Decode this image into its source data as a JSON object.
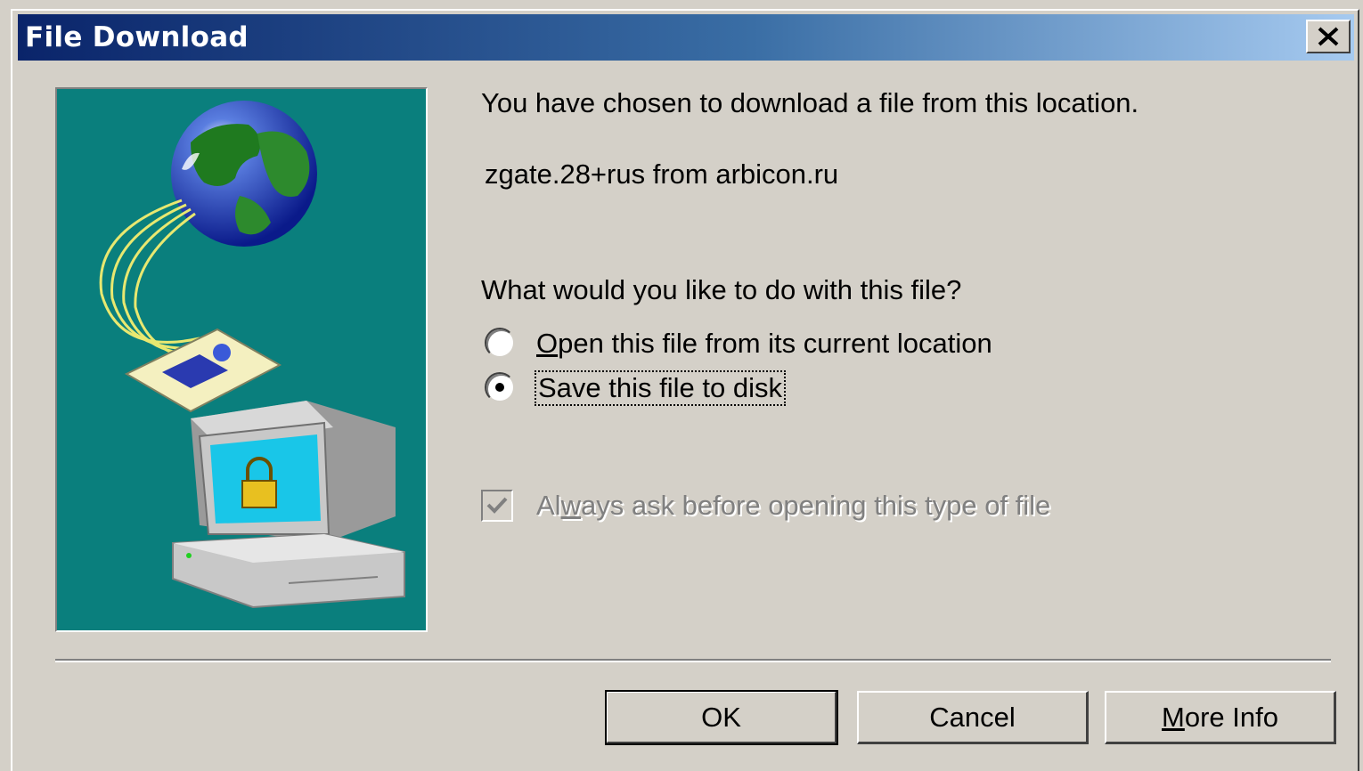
{
  "window": {
    "title": "File Download",
    "close_symbol": "×"
  },
  "message": {
    "intro": "You have chosen to download a file from this location.",
    "file_source": "zgate.28+rus from arbicon.ru",
    "question": "What would you like to do with this file?"
  },
  "options": {
    "open": {
      "label_underlined": "O",
      "label_rest": "pen this file from its current location",
      "selected": false
    },
    "save": {
      "label": "Save this file to disk",
      "selected": true
    }
  },
  "checkbox": {
    "label_pre": "Al",
    "label_underlined": "w",
    "label_rest": "ays ask before opening this type of file",
    "checked": true,
    "disabled": true
  },
  "buttons": {
    "ok": "OK",
    "cancel": "Cancel",
    "more_info_underlined": "M",
    "more_info_rest": "ore Info"
  },
  "icons": {
    "illustration": "globe-download-computer-illustration",
    "close": "close-icon"
  },
  "colors": {
    "titlebar_start": "#0a246a",
    "titlebar_end": "#a6caf0",
    "illustration_bg": "#0a7f7d",
    "dialog_bg": "#d4d0c8"
  }
}
